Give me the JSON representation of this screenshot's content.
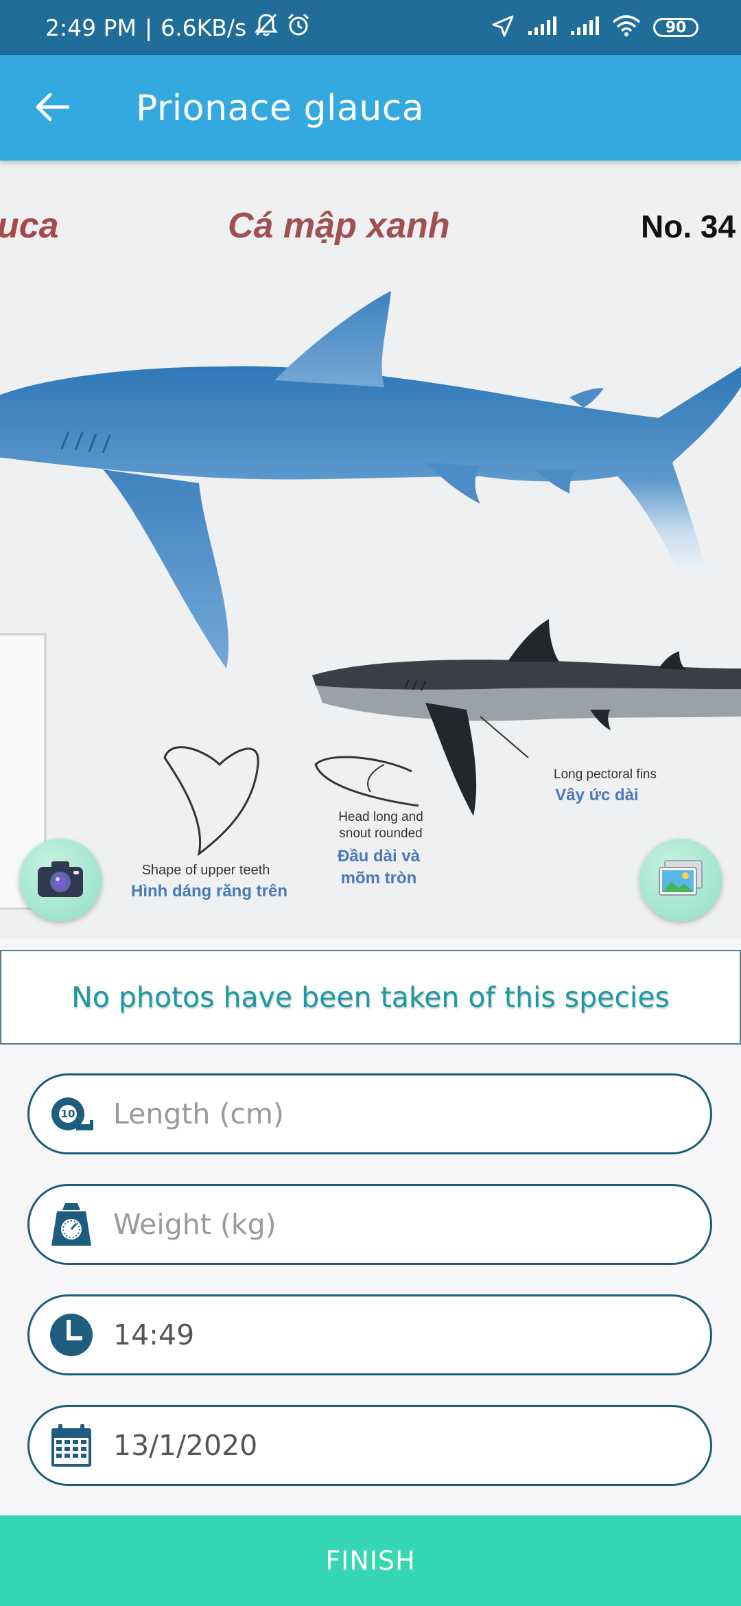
{
  "status_bar": {
    "time": "2:49 PM",
    "network_speed": "6.6KB/s",
    "battery": "90"
  },
  "app_bar": {
    "title": "Prionace glauca"
  },
  "hero_image": {
    "title_partial": "uca",
    "vietnamese_name": "Cá mập xanh",
    "number_label": "No. 34",
    "labels": {
      "teeth_en": "Shape of upper teeth",
      "teeth_vi": "Hình dáng răng trên",
      "head_en_1": "Head long and",
      "head_en_2": "snout rounded",
      "head_vi_1": "Đầu dài và",
      "head_vi_2": "mõm tròn",
      "fins_en": "Long pectoral fins",
      "fins_vi": "Vây ức dài"
    }
  },
  "photos_message": "No photos have been taken of this species",
  "form": {
    "length_placeholder": "Length (cm)",
    "length_icon_number": "10",
    "weight_placeholder": "Weight (kg)",
    "time_value": "14:49",
    "date_value": "13/1/2020"
  },
  "finish_label": "FINISH",
  "colors": {
    "status_bar": "#1f6d98",
    "app_bar": "#33a9df",
    "accent_teal": "#1a9aa3",
    "field_border": "#1a5c7a",
    "finish_button": "#34d6b4"
  },
  "icons": {
    "back": "arrow-left-icon",
    "camera": "camera-icon",
    "gallery": "image-gallery-icon",
    "length": "tape-measure-icon",
    "weight": "scale-icon",
    "time": "clock-icon",
    "date": "calendar-icon"
  }
}
